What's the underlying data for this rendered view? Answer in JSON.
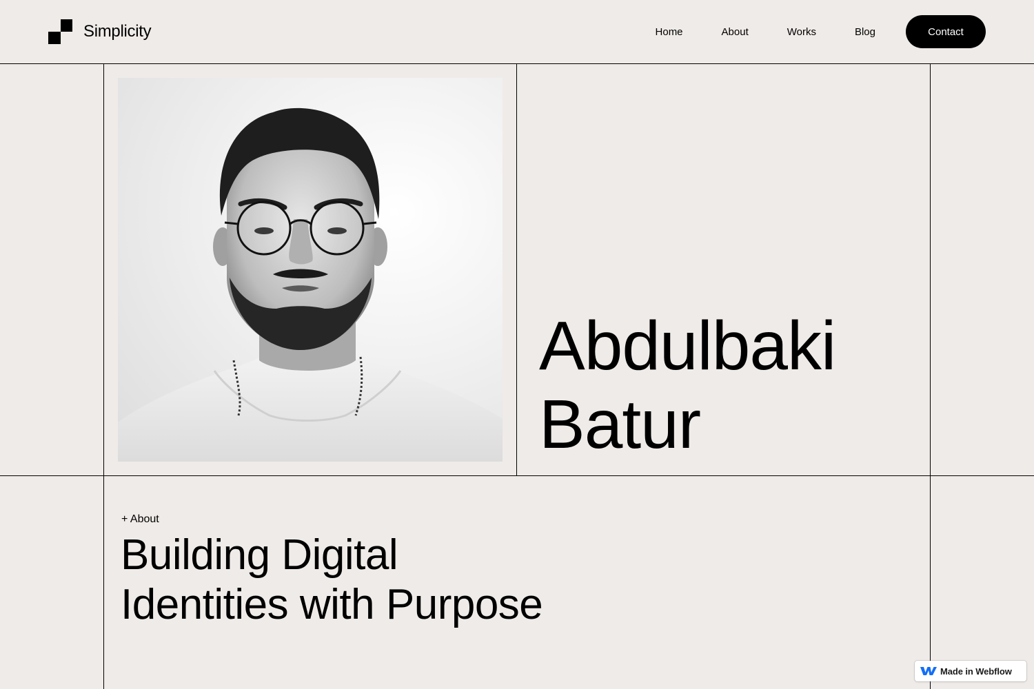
{
  "brand": {
    "name": "Simplicity",
    "logo_icon": "stair-squares-logo"
  },
  "nav": {
    "items": [
      {
        "label": "Home"
      },
      {
        "label": "About"
      },
      {
        "label": "Works"
      },
      {
        "label": "Blog"
      }
    ],
    "cta_label": "Contact"
  },
  "hero": {
    "image_icon": "portrait-photo",
    "name_lines": [
      "Abdulbaki",
      "Batur"
    ]
  },
  "about": {
    "tag": "+ About",
    "heading_lines": [
      "Building Digital",
      "Identities with Purpose"
    ]
  },
  "badge": {
    "label": "Made in Webflow",
    "icon": "webflow-icon",
    "icon_color": "#146ef5"
  },
  "colors": {
    "background": "#efebe8",
    "text": "#000000",
    "button_bg": "#000000",
    "button_text": "#ffffff"
  }
}
